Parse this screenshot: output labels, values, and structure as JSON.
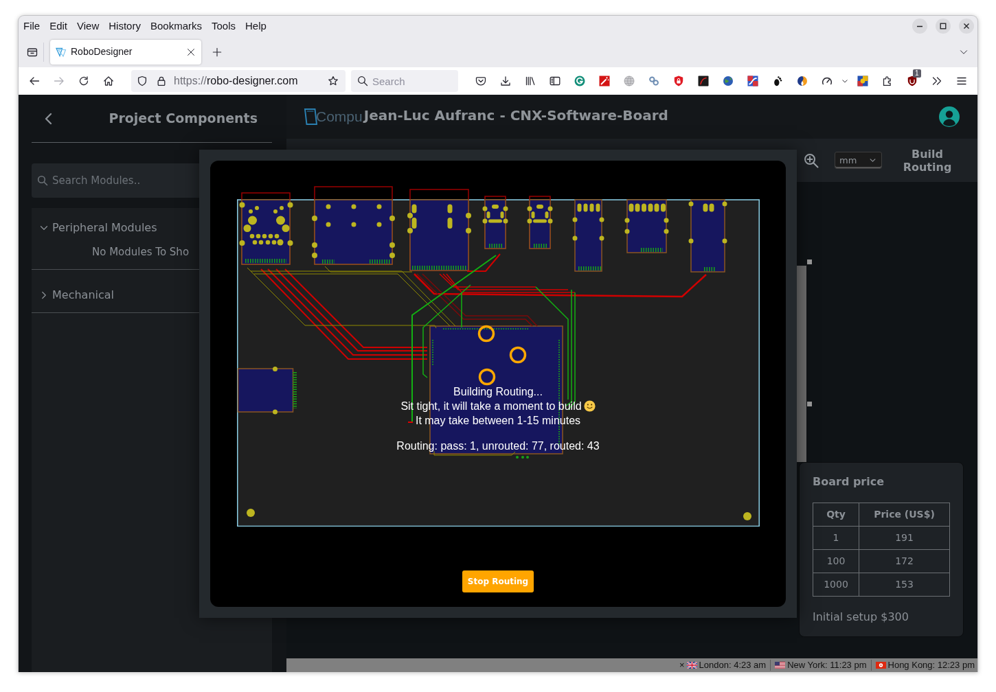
{
  "browser": {
    "menu": [
      "File",
      "Edit",
      "View",
      "History",
      "Bookmarks",
      "Tools",
      "Help"
    ],
    "tabs": [
      {
        "title": "RoboDesigner",
        "selected": true
      }
    ],
    "navigation": {
      "forward_disabled": true
    },
    "address": {
      "scheme": "https://",
      "host": "robo-designer.com"
    },
    "search": {
      "placeholder": "Search"
    },
    "extension_badge": "1"
  },
  "sidebar": {
    "title": "Project Components",
    "search": {
      "placeholder": "Search Modules.."
    },
    "groups": [
      {
        "label": "Peripheral Modules",
        "expanded": true,
        "empty_text": "No Modules To Sho"
      },
      {
        "label": "Mechanical",
        "expanded": false
      }
    ]
  },
  "header": {
    "logo_text": "Compu",
    "title": "Jean-Luc Aufranc - CNX-Software-Board"
  },
  "toolbar": {
    "unit": "mm",
    "build_button": "Build Routing"
  },
  "routing_dialog": {
    "lines": [
      {
        "text": "Building Routing...",
        "smiley": false
      },
      {
        "text": "Sit tight, it will take a moment to build",
        "smiley": true
      },
      {
        "text": "It may take between 1-15 minutes",
        "smiley": false
      }
    ],
    "progress": "Routing: pass: 1, unrouted: 77, routed: 43",
    "stop_button": "Stop Routing"
  },
  "board_price": {
    "title": "Board price",
    "columns": [
      "Qty",
      "Price (US$)"
    ],
    "rows": [
      [
        "1",
        "191"
      ],
      [
        "100",
        "172"
      ],
      [
        "1000",
        "153"
      ]
    ],
    "setup": "Initial setup $300"
  },
  "status_bar": {
    "close": "×",
    "clocks": [
      {
        "kind": "gb",
        "label": "London: 4:23 am"
      },
      {
        "kind": "us",
        "label": "New York: 11:23 pm"
      },
      {
        "kind": "hk",
        "label": "Hong Kong: 12:23 pm"
      }
    ]
  }
}
